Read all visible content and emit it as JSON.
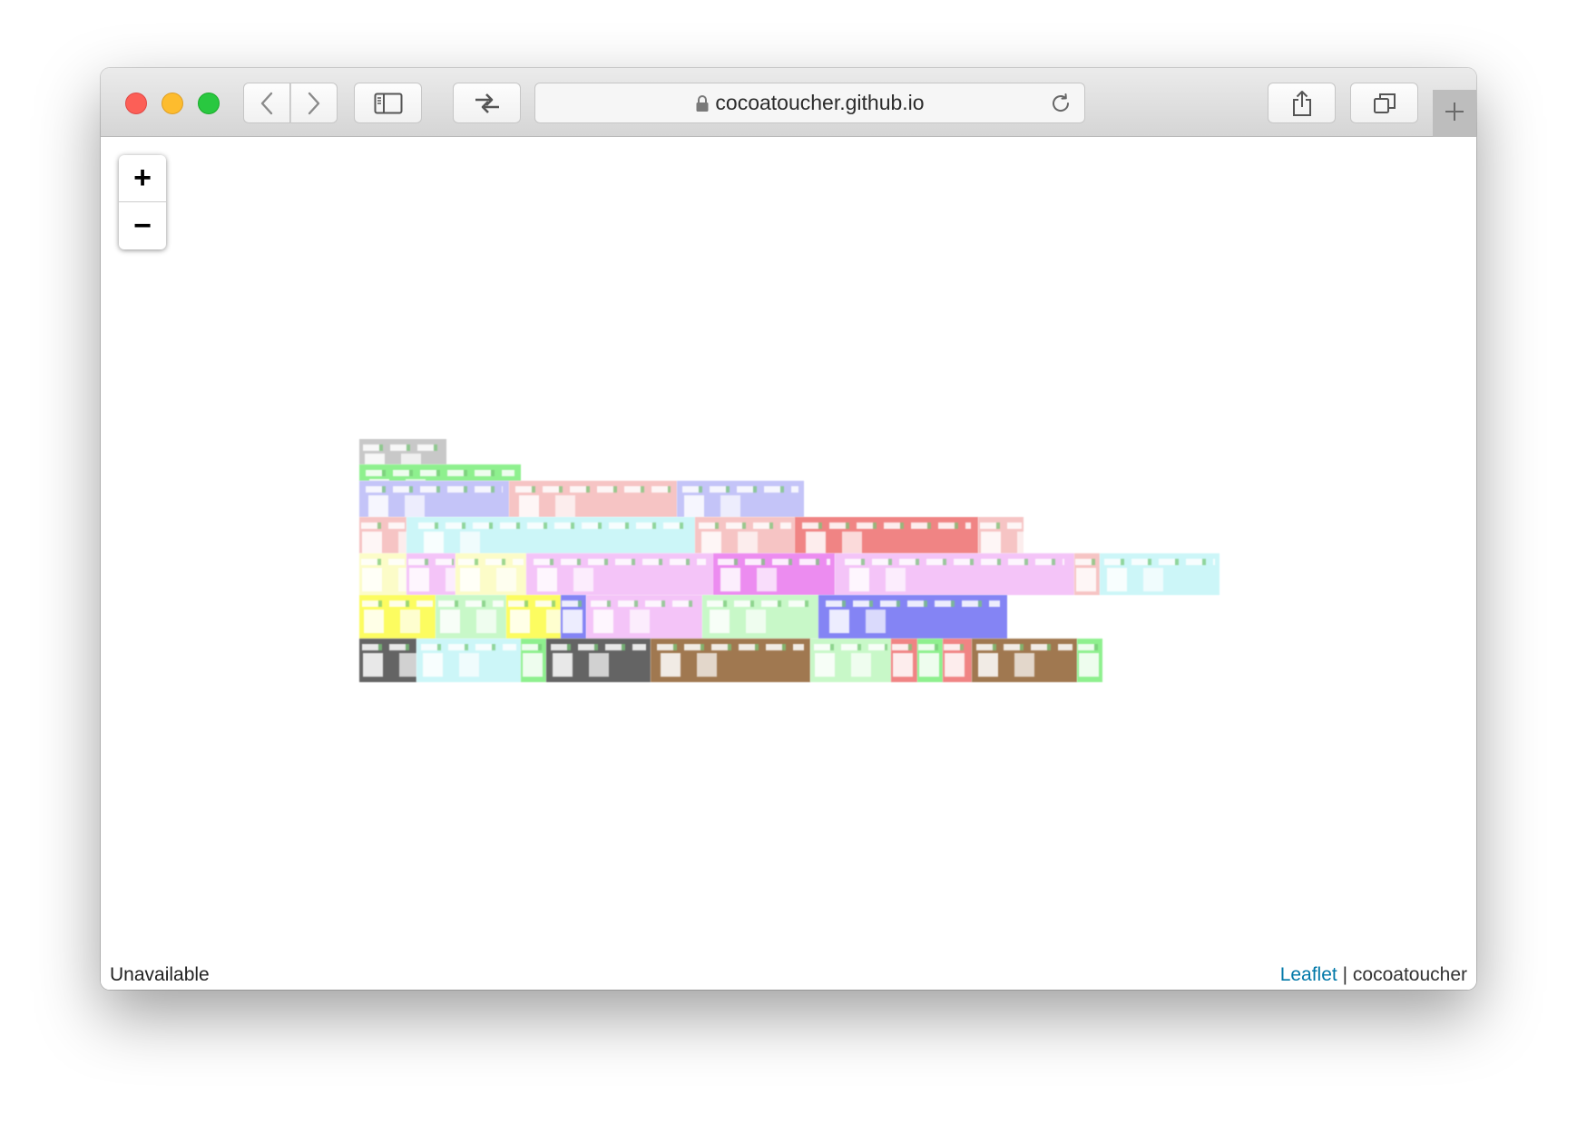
{
  "browser": {
    "url": "cocoatoucher.github.io",
    "icons": {
      "back": "chevron-left-icon",
      "forward": "chevron-right-icon",
      "sidebar": "sidebar-icon",
      "tabs": "tab-switch-icon",
      "lock": "lock-icon",
      "reload": "reload-icon",
      "share": "share-icon",
      "tab_overview": "tab-overview-icon",
      "new_tab": "plus-icon"
    }
  },
  "map": {
    "zoom_in_label": "+",
    "zoom_out_label": "−",
    "status_text": "Unavailable",
    "attribution_link": "Leaflet",
    "attribution_separator": "|",
    "attribution_text": "cocoatoucher",
    "tile_colors": {
      "gray": "#c8c8c8",
      "green": "#8ef08e",
      "lavender": "#c4c4f8",
      "pink": "#f6c4c4",
      "cyan": "#ccf6f8",
      "red": "#f08484",
      "yellow_light": "#fcfcc8",
      "magenta_light": "#f4c4f8",
      "magenta": "#ec8cf0",
      "yellow": "#fcfc60",
      "light_green": "#c8f8c8",
      "blue": "#8484f4",
      "dark_gray": "#646464",
      "brown": "#a07850"
    }
  }
}
